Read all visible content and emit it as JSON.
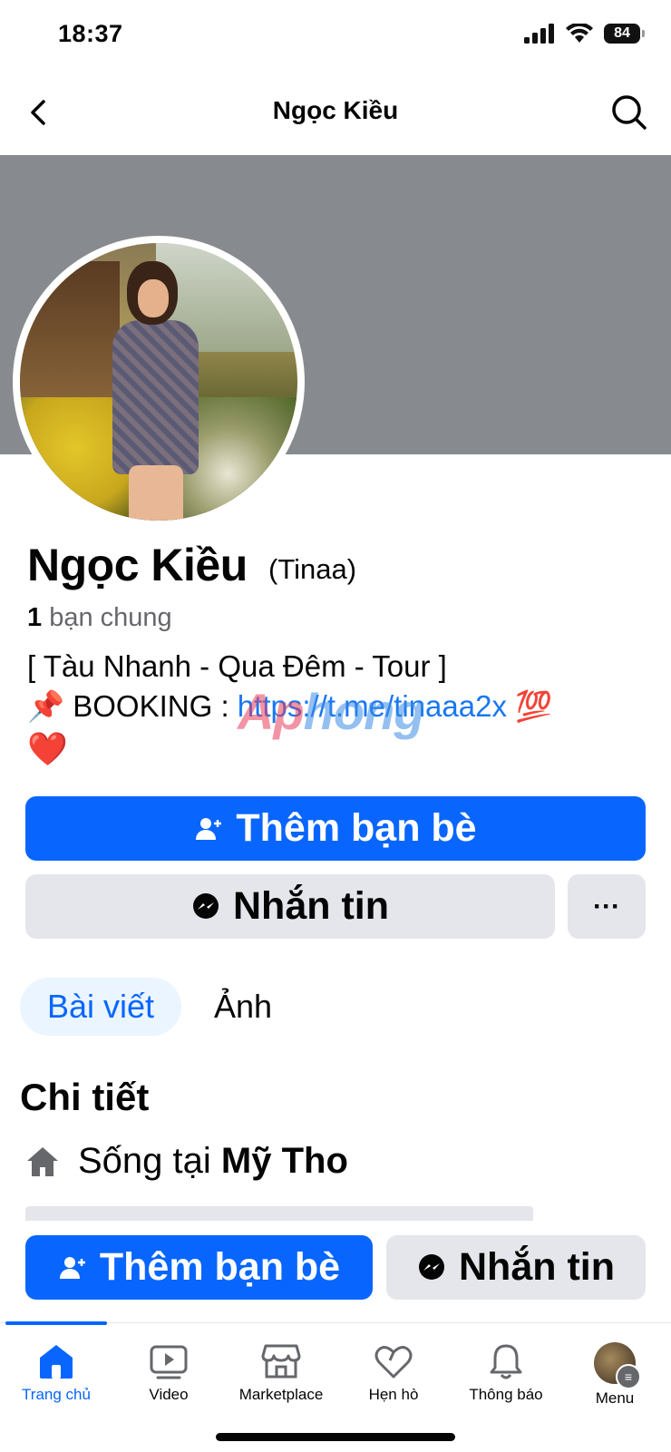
{
  "status_bar": {
    "time": "18:37",
    "battery": "84"
  },
  "header": {
    "title": "Ngọc Kiều"
  },
  "profile": {
    "name": "Ngọc Kiều",
    "nickname": "(Tinaa)",
    "mutual_count": "1",
    "mutual_label": "bạn chung",
    "bio_line1": "[ Tàu Nhanh - Qua Đêm - Tour ]",
    "bio_line2_prefix": "📌 BOOKING : ",
    "bio_link": "https://t.me/tinaaa2x",
    "bio_line2_suffix": " 💯",
    "bio_line3": "❤️",
    "watermark": "Aphong"
  },
  "actions": {
    "add_friend": "Thêm bạn bè",
    "message": "Nhắn tin",
    "more": "···"
  },
  "tabs": [
    {
      "label": "Bài viết",
      "active": true
    },
    {
      "label": "Ảnh",
      "active": false
    }
  ],
  "details": {
    "title": "Chi tiết",
    "lives_prefix": "Sống tại",
    "lives_place": "Mỹ Tho"
  },
  "nav": [
    {
      "label": "Trang chủ",
      "icon": "home-icon",
      "active": true
    },
    {
      "label": "Video",
      "icon": "video-icon",
      "active": false
    },
    {
      "label": "Marketplace",
      "icon": "marketplace-icon",
      "active": false
    },
    {
      "label": "Hẹn hò",
      "icon": "dating-icon",
      "active": false
    },
    {
      "label": "Thông báo",
      "icon": "bell-icon",
      "active": false
    },
    {
      "label": "Menu",
      "icon": "menu-avatar",
      "active": false
    }
  ],
  "colors": {
    "accent": "#0866ff",
    "secondary_bg": "#e4e6eb",
    "cover": "#878a8f"
  }
}
